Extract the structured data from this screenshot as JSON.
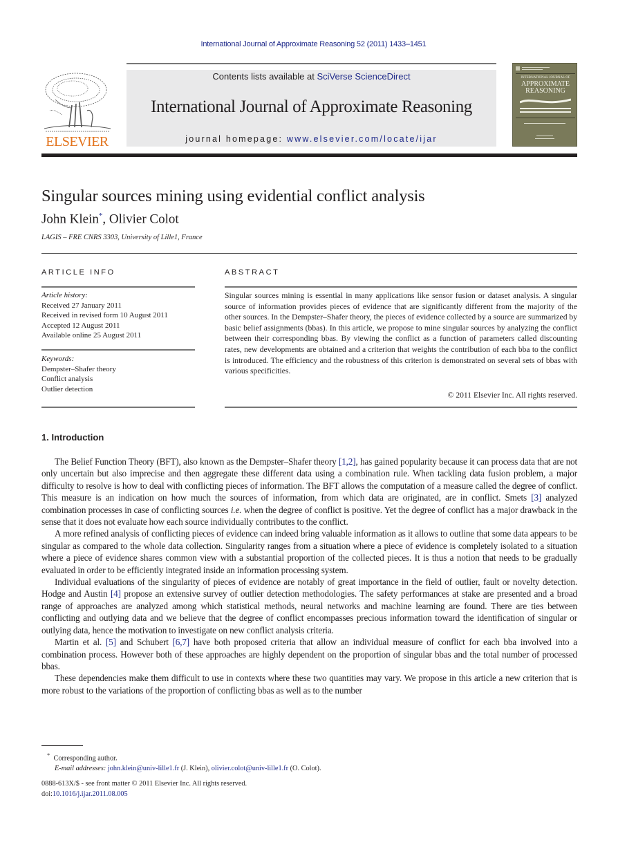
{
  "running_head": "International Journal of Approximate Reasoning 52 (2011) 1433–1451",
  "header": {
    "publisher": "ELSEVIER",
    "contents_prefix": "Contents lists available at ",
    "contents_link": "SciVerse ScienceDirect",
    "journal_name": "International Journal of Approximate Reasoning",
    "homepage_prefix": "journal homepage: ",
    "homepage_link": "www.elsevier.com/locate/ijar",
    "cover": {
      "line1": "INTERNATIONAL JOURNAL OF",
      "line2": "APPROXIMATE",
      "line3": "REASONING"
    }
  },
  "article": {
    "title": "Singular sources mining using evidential conflict analysis",
    "authors": "John Klein",
    "author_mark": "*",
    "authors_rest": ", Olivier Colot",
    "affiliation": "LAGIS – FRE CNRS 3303, University of Lille1, France"
  },
  "article_info": {
    "heading": "ARTICLE INFO",
    "history_label": "Article history:",
    "history": [
      "Received 27 January 2011",
      "Received in revised form 10 August 2011",
      "Accepted 12 August 2011",
      "Available online 25 August 2011"
    ],
    "keywords_label": "Keywords:",
    "keywords": [
      "Dempster–Shafer theory",
      "Conflict analysis",
      "Outlier detection"
    ]
  },
  "abstract": {
    "heading": "ABSTRACT",
    "text": "Singular sources mining is essential in many applications like sensor fusion or dataset analysis. A singular source of information provides pieces of evidence that are significantly different from the majority of the other sources. In the Dempster–Shafer theory, the pieces of evidence collected by a source are summarized by basic belief assignments (bbas). In this article, we propose to mine singular sources by analyzing the conflict between their corresponding bbas. By viewing the conflict as a function of parameters called discounting rates, new developments are obtained and a criterion that weights the contribution of each bba to the conflict is introduced. The efficiency and the robustness of this criterion is demonstrated on several sets of bbas with various specificities.",
    "copyright": "© 2011 Elsevier Inc. All rights reserved."
  },
  "introduction": {
    "heading": "1. Introduction",
    "paragraphs": [
      [
        {
          "t": "The Belief Function Theory (BFT), also known as the Dempster–Shafer theory "
        },
        {
          "t": "[1,2]",
          "ref": true
        },
        {
          "t": ", has gained popularity because it can process data that are not only uncertain but also imprecise and then aggregate these different data using a combination rule. When tackling data fusion problem, a major difficulty to resolve is how to deal with conflicting pieces of information. The BFT allows the computation of a measure called the degree of conflict. This measure is an indication on how much the sources of information, from which data are originated, are in conflict. Smets "
        },
        {
          "t": "[3]",
          "ref": true
        },
        {
          "t": " analyzed combination processes in case of conflicting sources "
        },
        {
          "t": "i.e.",
          "it": true
        },
        {
          "t": " when the degree of conflict is positive. Yet the degree of conflict has a major drawback in the sense that it does not evaluate how each source individually contributes to the conflict."
        }
      ],
      [
        {
          "t": "A more refined analysis of conflicting pieces of evidence can indeed bring valuable information as it allows to outline that some data appears to be singular as compared to the whole data collection. Singularity ranges from a situation where a piece of evidence is completely isolated to a situation where a piece of evidence shares common view with a substantial proportion of the collected pieces. It is thus a notion that needs to be gradually evaluated in order to be efficiently integrated inside an information processing system."
        }
      ],
      [
        {
          "t": "Individual evaluations of the singularity of pieces of evidence are notably of great importance in the field of outlier, fault or novelty detection. Hodge and Austin "
        },
        {
          "t": "[4]",
          "ref": true
        },
        {
          "t": " propose an extensive survey of outlier detection methodologies. The safety performances at stake are presented and a broad range of approaches are analyzed among which statistical methods, neural networks and machine learning are found. There are ties between conflicting and outlying data and we believe that the degree of conflict encompasses precious information toward the identification of singular or outlying data, hence the motivation to investigate on new conflict analysis criteria."
        }
      ],
      [
        {
          "t": "Martin et al. "
        },
        {
          "t": "[5]",
          "ref": true
        },
        {
          "t": " and Schubert "
        },
        {
          "t": "[6,7]",
          "ref": true
        },
        {
          "t": " have both proposed criteria that allow an individual measure of conflict for each bba involved into a combination process. However both of these approaches are highly dependent on the proportion of singular bbas and the total number of processed bbas."
        }
      ],
      [
        {
          "t": "These dependencies make them difficult to use in contexts where these two quantities may vary. We propose in this article a new criterion that is more robust to the variations of the proportion of conflicting bbas as well as to the number"
        }
      ]
    ]
  },
  "footnote": {
    "mark": "*",
    "corresponding": "Corresponding author.",
    "email_label": "E-mail addresses:",
    "email1": "john.klein@univ-lille1.fr",
    "email1_name": " (J. Klein), ",
    "email2": "olivier.colot@univ-lille1.fr",
    "email2_name": " (O. Colot)."
  },
  "front_matter": {
    "issn_line": "0888-613X/$ - see front matter © 2011 Elsevier Inc. All rights reserved.",
    "doi_label": "doi:",
    "doi": "10.1016/j.ijar.2011.08.005"
  }
}
